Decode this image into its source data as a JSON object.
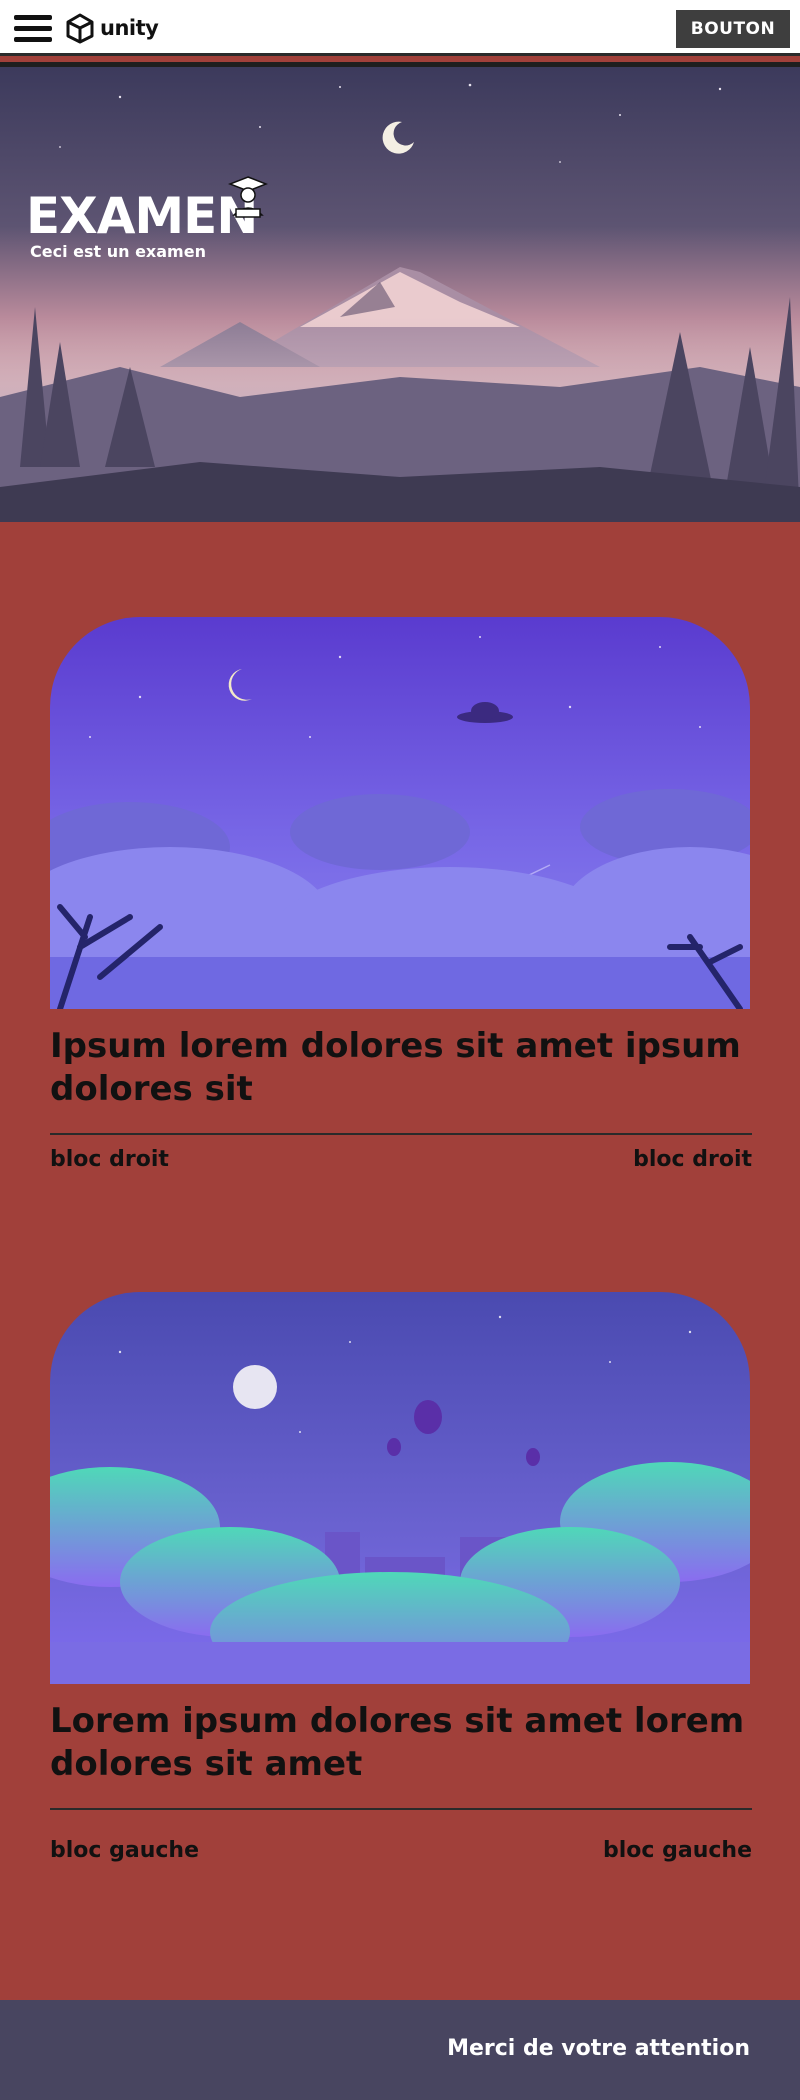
{
  "header": {
    "logo_text": "unity",
    "button_label": "BOUTON"
  },
  "hero": {
    "title": "EXAMEN",
    "subtitle": "Ceci est un examen"
  },
  "cards": [
    {
      "title": "Ipsum lorem dolores sit amet ipsum dolores sit",
      "meta_left": "bloc droit",
      "meta_right": "bloc droit"
    },
    {
      "title": "Lorem ipsum dolores sit amet lorem dolores sit amet",
      "meta_left": "bloc gauche",
      "meta_right": "bloc gauche"
    }
  ],
  "footer": {
    "text": "Merci de votre attention"
  },
  "icons": [
    "menu-icon",
    "unity-logo-icon",
    "graduate-icon",
    "moon-icon",
    "ufo-icon",
    "hot-air-balloon-icon"
  ],
  "colors": {
    "page_background": "#a1403a",
    "button_background": "#3e3e3e",
    "footer_background": "#484560",
    "header_background": "#ffffff"
  }
}
